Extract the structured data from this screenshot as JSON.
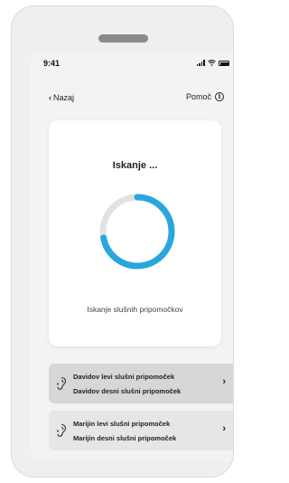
{
  "status_bar": {
    "time": "9:41"
  },
  "nav": {
    "back_label": "Nazaj",
    "help_label": "Pomoč"
  },
  "search": {
    "title": "Iskanje ...",
    "status": "Iskanje slušnih pripomočkov",
    "progress": 0.72
  },
  "devices": [
    {
      "left": "Davidov levi slušni pripomoček",
      "right": "Davidov desni slušni pripomoček"
    },
    {
      "left": "Marijin levi slušni pripomoček",
      "right": "Marijin desni slušni pripomoček"
    }
  ],
  "colors": {
    "accent": "#2aa6dc",
    "track": "#e2e2e2",
    "card_selected": "#d7d7d7",
    "card": "#e6e6e6"
  }
}
